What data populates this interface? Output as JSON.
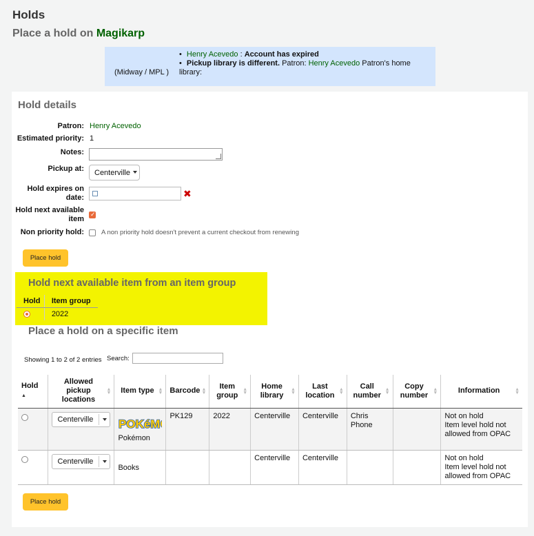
{
  "page_title": "Holds",
  "subtitle_prefix": "Place a hold on",
  "subtitle_link": "Magikarp",
  "alert": {
    "line1_patron": "Henry Acevedo",
    "line1_sep": " : ",
    "line1_msg": "Account has expired",
    "line2_bold": "Pickup library is different.",
    "line2_patron_label": " Patron: ",
    "line2_patron": "Henry Acevedo",
    "line2_suffix": " Patron's home library:",
    "line2_library": "(Midway / MPL )"
  },
  "hold_details": {
    "title": "Hold details",
    "patron_label": "Patron:",
    "patron_value": "Henry Acevedo",
    "priority_label": "Estimated priority:",
    "priority_value": "1",
    "notes_label": "Notes:",
    "pickup_label": "Pickup at:",
    "pickup_value": "Centerville",
    "expires_label_1": "Hold expires on",
    "expires_label_2": "date:",
    "next_label_1": "Hold next available",
    "next_label_2": "item",
    "nonpriority_label": "Non priority hold:",
    "nonpriority_hint": "A non priority hold doesn't prevent a current checkout from renewing",
    "place_hold_label": "Place hold"
  },
  "item_group": {
    "title": "Hold next available item from an item group",
    "columns": [
      "Hold",
      "Item group"
    ],
    "rows": [
      {
        "group": "2022"
      }
    ]
  },
  "specific": {
    "title": "Place a hold on a specific item",
    "showing": "Showing 1 to 2 of 2 entries",
    "search_label": "Search:",
    "columns": [
      "Hold",
      "Allowed pickup locations",
      "Item type",
      "Barcode",
      "Item group",
      "Home library",
      "Last location",
      "Call number",
      "Copy number",
      "Information"
    ],
    "rows": [
      {
        "pickup": "Centerville",
        "itemtype": "Pokémon",
        "barcode": "PK129",
        "group": "2022",
        "home": "Centerville",
        "last": "Centerville",
        "call_1": "Chris",
        "call_2": "Phone",
        "copy": "",
        "info_1": "Not on hold",
        "info_2": "Item level hold not",
        "info_3": "allowed from OPAC"
      },
      {
        "pickup": "Centerville",
        "itemtype": "Books",
        "barcode": "",
        "group": "",
        "home": "Centerville",
        "last": "Centerville",
        "call_1": "",
        "call_2": "",
        "copy": "",
        "info_1": "Not on hold",
        "info_2": "Item level hold not",
        "info_3": "allowed from OPAC"
      }
    ],
    "place_hold_label": "Place hold"
  },
  "colors": {
    "link": "#006100",
    "alert_bg": "#d3e5fd",
    "highlight": "#f3f300",
    "button": "#ffc32b",
    "checkbox_accent": "#e86a3a"
  }
}
